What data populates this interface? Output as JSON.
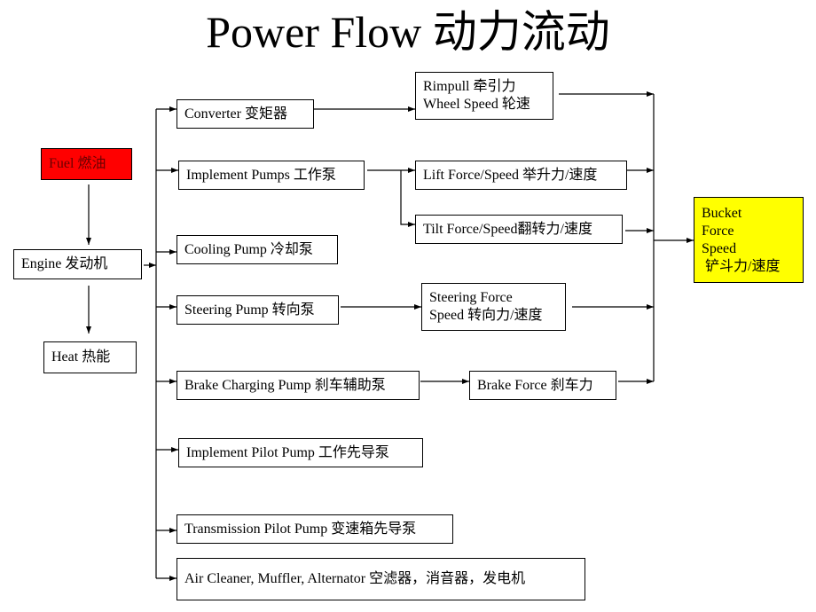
{
  "title": "Power Flow 动力流动",
  "colors": {
    "fuel_fill": "#ff0000",
    "bucket_fill": "#ffff00",
    "line": "#000000"
  },
  "nodes": {
    "fuel": "Fuel  燃油",
    "engine": "Engine  发动机",
    "heat": "Heat  热能",
    "converter": "Converter 变矩器",
    "implement_pumps": "Implement Pumps 工作泵",
    "cooling_pump": "Cooling Pump 冷却泵",
    "steering_pump": "Steering Pump 转向泵",
    "brake_charging_pump": "Brake Charging  Pump 刹车辅助泵",
    "implement_pilot_pump": "Implement Pilot Pump 工作先导泵",
    "transmission_pilot_pump": "Transmission Pilot Pump 变速箱先导泵",
    "accessories": "Air Cleaner, Muffler, Alternator 空滤器，消音器，发电机",
    "rimpull": [
      "Rimpull 牵引力",
      "Wheel Speed 轮速"
    ],
    "lift_force": "Lift Force/Speed 举升力/速度",
    "tilt_force": "Tilt Force/Speed翻转力/速度",
    "steering_force": [
      "Steering Force",
      "Speed 转向力/速度"
    ],
    "brake_force": "Brake Force 刹车力",
    "bucket": [
      "Bucket",
      "Force",
      "Speed",
      " 铲斗力/速度"
    ]
  },
  "edges": [
    [
      "fuel",
      "engine"
    ],
    [
      "engine",
      "heat"
    ],
    [
      "engine",
      "converter"
    ],
    [
      "engine",
      "implement_pumps"
    ],
    [
      "engine",
      "cooling_pump"
    ],
    [
      "engine",
      "steering_pump"
    ],
    [
      "engine",
      "brake_charging_pump"
    ],
    [
      "engine",
      "implement_pilot_pump"
    ],
    [
      "engine",
      "transmission_pilot_pump"
    ],
    [
      "engine",
      "accessories"
    ],
    [
      "converter",
      "rimpull"
    ],
    [
      "implement_pumps",
      "lift_force"
    ],
    [
      "implement_pumps",
      "tilt_force"
    ],
    [
      "steering_pump",
      "steering_force"
    ],
    [
      "brake_charging_pump",
      "brake_force"
    ],
    [
      "rimpull",
      "bucket"
    ],
    [
      "lift_force",
      "bucket"
    ],
    [
      "tilt_force",
      "bucket"
    ],
    [
      "steering_force",
      "bucket"
    ],
    [
      "brake_force",
      "bucket"
    ]
  ]
}
